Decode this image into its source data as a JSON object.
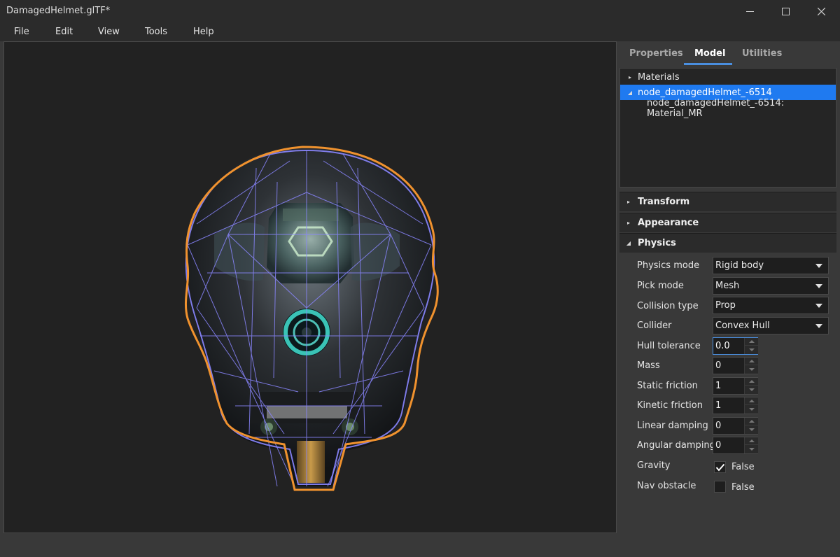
{
  "window": {
    "title": "DamagedHelmet.glTF*",
    "minimize_icon": "minimize-icon",
    "maximize_icon": "maximize-icon",
    "close_icon": "close-icon"
  },
  "menu": [
    "File",
    "Edit",
    "View",
    "Tools",
    "Help"
  ],
  "tabs": [
    {
      "label": "Properties",
      "active": false
    },
    {
      "label": "Model",
      "active": true
    },
    {
      "label": "Utilities",
      "active": false
    }
  ],
  "tree": [
    {
      "label": "Materials",
      "expanded": false,
      "selected": false
    },
    {
      "label": "node_damagedHelmet_-6514",
      "expanded": true,
      "selected": true
    },
    {
      "label": "node_damagedHelmet_-6514: Material_MR",
      "expanded": false,
      "selected": false
    }
  ],
  "sections": [
    {
      "label": "Transform",
      "expanded": false
    },
    {
      "label": "Appearance",
      "expanded": false
    },
    {
      "label": "Physics",
      "expanded": true
    }
  ],
  "physics": {
    "physics_mode": {
      "label": "Physics mode",
      "value": "Rigid body"
    },
    "pick_mode": {
      "label": "Pick mode",
      "value": "Mesh"
    },
    "collision_type": {
      "label": "Collision type",
      "value": "Prop"
    },
    "collider": {
      "label": "Collider",
      "value": "Convex Hull"
    },
    "hull_tolerance": {
      "label": "Hull tolerance",
      "value": "0.0"
    },
    "mass": {
      "label": "Mass",
      "value": "0"
    },
    "static_friction": {
      "label": "Static friction",
      "value": "1"
    },
    "kinetic_friction": {
      "label": "Kinetic friction",
      "value": "1"
    },
    "linear_damping": {
      "label": "Linear damping",
      "value": "0"
    },
    "angular_damping": {
      "label": "Angular damping",
      "value": "0"
    },
    "gravity": {
      "label": "Gravity",
      "checked": true,
      "text": "False"
    },
    "nav_obstacle": {
      "label": "Nav obstacle",
      "checked": false,
      "text": "False"
    }
  },
  "colors": {
    "accent": "#1f7af0",
    "selection_outline": "#f0922e",
    "wireframe": "#8a86ff",
    "emissive": "#3fd6c8"
  }
}
